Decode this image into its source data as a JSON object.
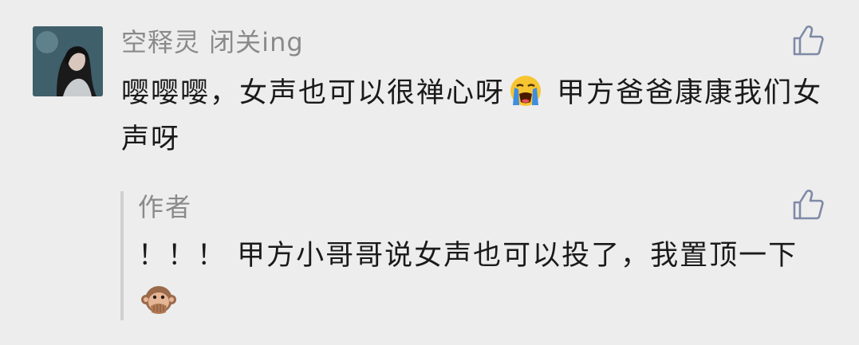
{
  "comment": {
    "user_name": "空释灵 闭关ing",
    "avatar_icon": "user-avatar",
    "text_part1": "嘤嘤嘤，女声也可以很禅心呀",
    "emoji1": "loudly-crying-face-icon",
    "text_part2": " 甲方爸爸康康我们女声呀",
    "like_icon": "thumbs-up-icon"
  },
  "reply": {
    "author_label": "作者",
    "text": "！！！ 甲方小哥哥说女声也可以投了，我置顶一下",
    "emoji": "speak-no-evil-monkey-icon",
    "like_icon": "thumbs-up-icon"
  },
  "colors": {
    "background": "#ededed",
    "name_gray": "#8a8a8a",
    "text_dark": "#1a1a1a",
    "like_blue": "#7f8aa6",
    "reply_bar": "#d0d0d0"
  }
}
